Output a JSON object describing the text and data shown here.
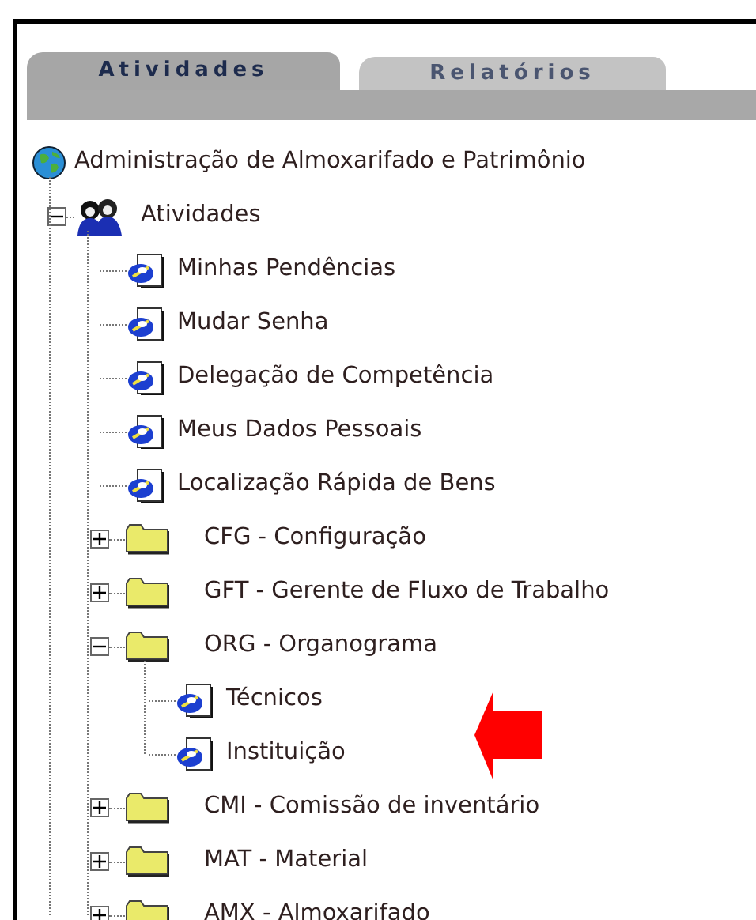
{
  "tabs": [
    {
      "label": "Atividades",
      "selected": true
    },
    {
      "label": "Relatórios",
      "selected": false
    }
  ],
  "tree": [
    {
      "label": "Administração de Almoxarifado e Patrimônio",
      "kind": "globe",
      "children": [
        {
          "label": "Atividades",
          "kind": "group",
          "expanded": true,
          "children": [
            {
              "label": "Minhas Pendências",
              "kind": "page"
            },
            {
              "label": "Mudar Senha",
              "kind": "page"
            },
            {
              "label": "Delegação de Competência",
              "kind": "page"
            },
            {
              "label": "Meus Dados Pessoais",
              "kind": "page"
            },
            {
              "label": "Localização Rápida de Bens",
              "kind": "page"
            },
            {
              "label": "CFG - Configuração",
              "kind": "folder",
              "expanded": false
            },
            {
              "label": "GFT - Gerente de Fluxo de Trabalho",
              "kind": "folder",
              "expanded": false
            },
            {
              "label": "ORG - Organograma",
              "kind": "folder",
              "expanded": true,
              "children": [
                {
                  "label": "Técnicos",
                  "kind": "page"
                },
                {
                  "label": "Instituição",
                  "kind": "page"
                }
              ]
            },
            {
              "label": "CMI - Comissão de inventário",
              "kind": "folder",
              "expanded": false
            },
            {
              "label": "MAT - Material",
              "kind": "folder",
              "expanded": false
            },
            {
              "label": "AMX - Almoxarifado",
              "kind": "folder",
              "expanded": false
            }
          ]
        }
      ]
    }
  ]
}
